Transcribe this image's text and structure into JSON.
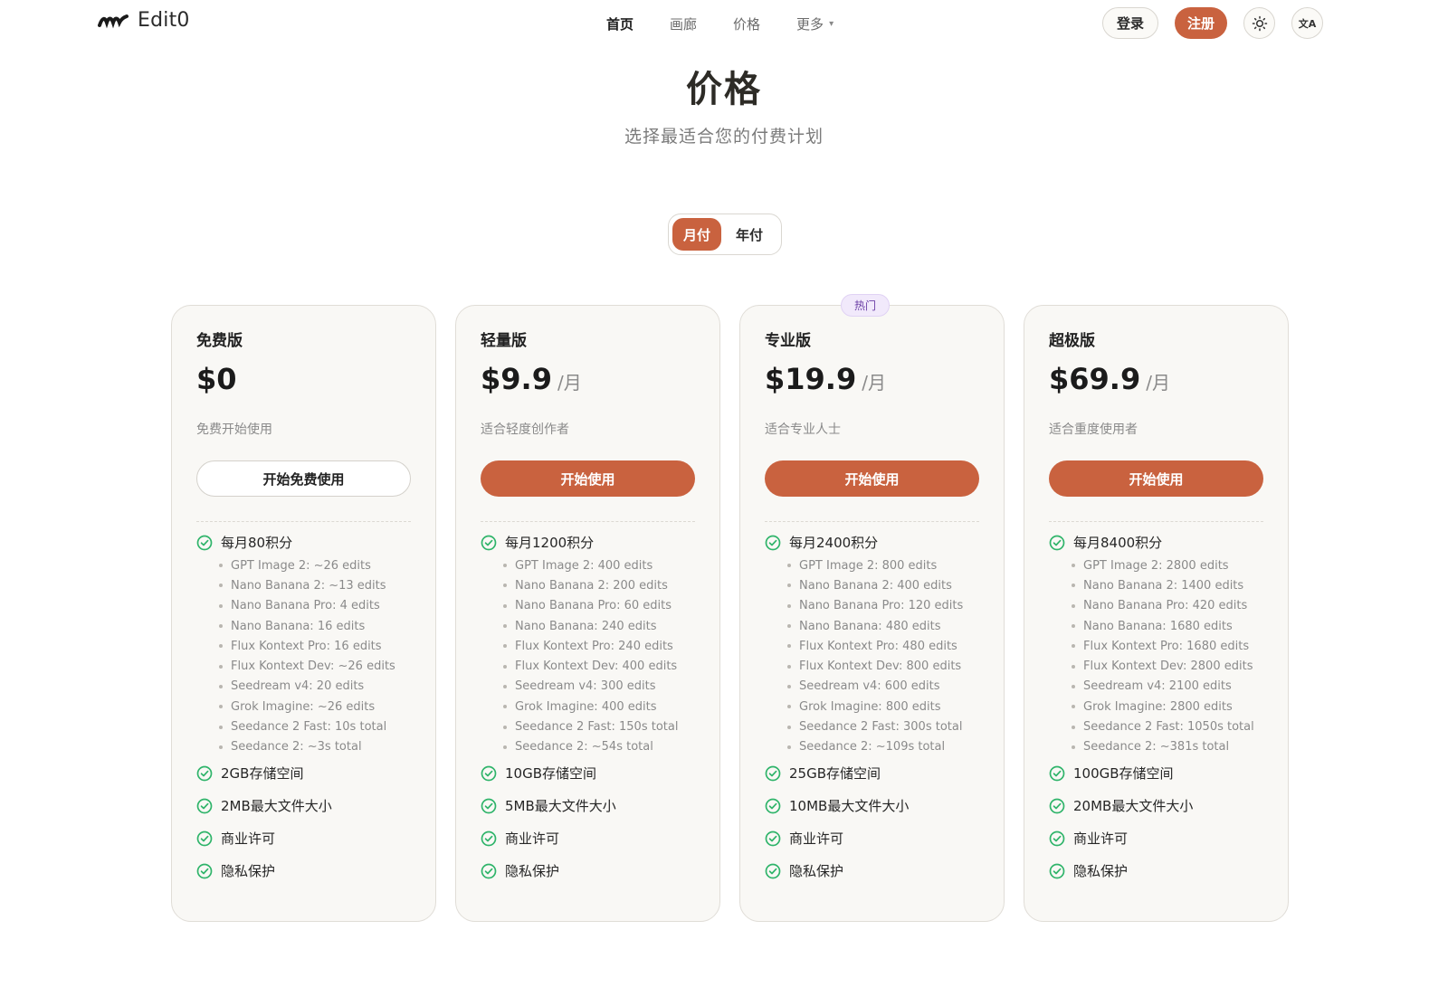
{
  "header": {
    "brand": "Edit0",
    "nav": [
      {
        "label": "首页",
        "active": true
      },
      {
        "label": "画廊",
        "active": false
      },
      {
        "label": "价格",
        "active": false
      },
      {
        "label": "更多",
        "active": false
      }
    ],
    "login": "登录",
    "signup": "注册",
    "lang_icon_text": "文A"
  },
  "title": "价格",
  "subtitle": "选择最适合您的付费计划",
  "billing_toggle": {
    "monthly": "月付",
    "yearly": "年付",
    "selected": "monthly"
  },
  "popular_badge": "热门",
  "colors": {
    "accent": "#c9623f",
    "check": "#2fb46a",
    "badge_bg": "#f1e9fb"
  },
  "plans": [
    {
      "name": "免费版",
      "price": "$0",
      "per": "",
      "desc": "免费开始使用",
      "cta": "开始免费使用",
      "cta_style": "outline",
      "credits": "每月80积分",
      "sub": [
        "GPT Image 2: ~26 edits",
        "Nano Banana 2: ~13 edits",
        "Nano Banana Pro: 4 edits",
        "Nano Banana: 16 edits",
        "Flux Kontext Pro: 16 edits",
        "Flux Kontext Dev: ~26 edits",
        "Seedream v4: 20 edits",
        "Grok Imagine: ~26 edits",
        "Seedance 2 Fast: 10s total",
        "Seedance 2: ~3s total"
      ],
      "storage": "2GB存储空间",
      "max_file": "2MB最大文件大小",
      "license": "商业许可",
      "privacy": "隐私保护"
    },
    {
      "name": "轻量版",
      "price": "$9.9",
      "per": "/月",
      "desc": "适合轻度创作者",
      "cta": "开始使用",
      "cta_style": "primary",
      "credits": "每月1200积分",
      "sub": [
        "GPT Image 2: 400 edits",
        "Nano Banana 2: 200 edits",
        "Nano Banana Pro: 60 edits",
        "Nano Banana: 240 edits",
        "Flux Kontext Pro: 240 edits",
        "Flux Kontext Dev: 400 edits",
        "Seedream v4: 300 edits",
        "Grok Imagine: 400 edits",
        "Seedance 2 Fast: 150s total",
        "Seedance 2: ~54s total"
      ],
      "storage": "10GB存储空间",
      "max_file": "5MB最大文件大小",
      "license": "商业许可",
      "privacy": "隐私保护"
    },
    {
      "name": "专业版",
      "price": "$19.9",
      "per": "/月",
      "desc": "适合专业人士",
      "cta": "开始使用",
      "cta_style": "primary",
      "credits": "每月2400积分",
      "sub": [
        "GPT Image 2: 800 edits",
        "Nano Banana 2: 400 edits",
        "Nano Banana Pro: 120 edits",
        "Nano Banana: 480 edits",
        "Flux Kontext Pro: 480 edits",
        "Flux Kontext Dev: 800 edits",
        "Seedream v4: 600 edits",
        "Grok Imagine: 800 edits",
        "Seedance 2 Fast: 300s total",
        "Seedance 2: ~109s total"
      ],
      "storage": "25GB存储空间",
      "max_file": "10MB最大文件大小",
      "license": "商业许可",
      "privacy": "隐私保护"
    },
    {
      "name": "超极版",
      "price": "$69.9",
      "per": "/月",
      "desc": "适合重度使用者",
      "cta": "开始使用",
      "cta_style": "primary",
      "credits": "每月8400积分",
      "sub": [
        "GPT Image 2: 2800 edits",
        "Nano Banana 2: 1400 edits",
        "Nano Banana Pro: 420 edits",
        "Nano Banana: 1680 edits",
        "Flux Kontext Pro: 1680 edits",
        "Flux Kontext Dev: 2800 edits",
        "Seedream v4: 2100 edits",
        "Grok Imagine: 2800 edits",
        "Seedance 2 Fast: 1050s total",
        "Seedance 2: ~381s total"
      ],
      "storage": "100GB存储空间",
      "max_file": "20MB最大文件大小",
      "license": "商业许可",
      "privacy": "隐私保护"
    }
  ]
}
